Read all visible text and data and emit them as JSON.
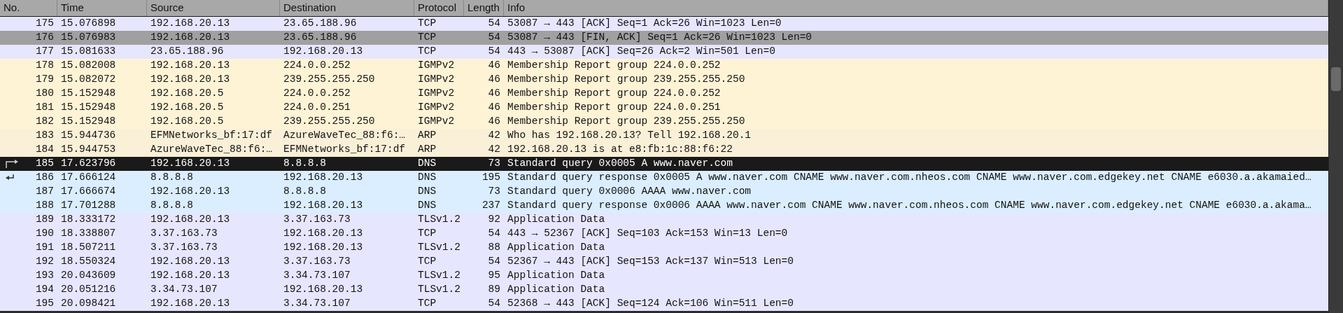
{
  "table": {
    "columns": [
      "No.",
      "Time",
      "Source",
      "Destination",
      "Protocol",
      "Length",
      "Info"
    ],
    "rows": [
      {
        "cells": [
          "175",
          "15.076898",
          "192.168.20.13",
          "23.65.188.96",
          "TCP",
          "54",
          "53087 → 443 [ACK] Seq=1 Ack=26 Win=1023 Len=0"
        ],
        "color": "#e7e6ff",
        "selected": false
      },
      {
        "cells": [
          "176",
          "15.076983",
          "192.168.20.13",
          "23.65.188.96",
          "TCP",
          "54",
          "53087 → 443 [FIN, ACK] Seq=1 Ack=26 Win=1023 Len=0"
        ],
        "color": "#a0a0a0",
        "selected": false
      },
      {
        "cells": [
          "177",
          "15.081633",
          "23.65.188.96",
          "192.168.20.13",
          "TCP",
          "54",
          "443 → 53087 [ACK] Seq=26 Ack=2 Win=501 Len=0"
        ],
        "color": "#e7e6ff",
        "selected": false
      },
      {
        "cells": [
          "178",
          "15.082008",
          "192.168.20.13",
          "224.0.0.252",
          "IGMPv2",
          "46",
          "Membership Report group 224.0.0.252"
        ],
        "color": "#fff3d6",
        "selected": false
      },
      {
        "cells": [
          "179",
          "15.082072",
          "192.168.20.13",
          "239.255.255.250",
          "IGMPv2",
          "46",
          "Membership Report group 239.255.255.250"
        ],
        "color": "#fff3d6",
        "selected": false
      },
      {
        "cells": [
          "180",
          "15.152948",
          "192.168.20.5",
          "224.0.0.252",
          "IGMPv2",
          "46",
          "Membership Report group 224.0.0.252"
        ],
        "color": "#fff3d6",
        "selected": false
      },
      {
        "cells": [
          "181",
          "15.152948",
          "192.168.20.5",
          "224.0.0.251",
          "IGMPv2",
          "46",
          "Membership Report group 224.0.0.251"
        ],
        "color": "#fff3d6",
        "selected": false
      },
      {
        "cells": [
          "182",
          "15.152948",
          "192.168.20.5",
          "239.255.255.250",
          "IGMPv2",
          "46",
          "Membership Report group 239.255.255.250"
        ],
        "color": "#fff3d6",
        "selected": false
      },
      {
        "cells": [
          "183",
          "15.944736",
          "EFMNetworks_bf:17:df",
          "AzureWaveTec_88:f6:…",
          "ARP",
          "42",
          "Who has 192.168.20.13? Tell 192.168.20.1"
        ],
        "color": "#faf0d7",
        "selected": false
      },
      {
        "cells": [
          "184",
          "15.944753",
          "AzureWaveTec_88:f6:…",
          "EFMNetworks_bf:17:df",
          "ARP",
          "42",
          "192.168.20.13 is at e8:fb:1c:88:f6:22"
        ],
        "color": "#faf0d7",
        "selected": false
      },
      {
        "cells": [
          "185",
          "17.623796",
          "192.168.20.13",
          "8.8.8.8",
          "DNS",
          "73",
          "Standard query 0x0005 A www.naver.com"
        ],
        "selected": true,
        "kind": "request"
      },
      {
        "cells": [
          "186",
          "17.666124",
          "8.8.8.8",
          "192.168.20.13",
          "DNS",
          "195",
          "Standard query response 0x0005 A www.naver.com CNAME www.naver.com.nheos.com CNAME www.naver.com.edgekey.net CNAME e6030.a.akamaied…"
        ],
        "color": "#daeeff",
        "selected": false,
        "kind": "response"
      },
      {
        "cells": [
          "187",
          "17.666674",
          "192.168.20.13",
          "8.8.8.8",
          "DNS",
          "73",
          "Standard query 0x0006 AAAA www.naver.com"
        ],
        "color": "#daeeff",
        "selected": false
      },
      {
        "cells": [
          "188",
          "17.701288",
          "8.8.8.8",
          "192.168.20.13",
          "DNS",
          "237",
          "Standard query response 0x0006 AAAA www.naver.com CNAME www.naver.com.nheos.com CNAME www.naver.com.edgekey.net CNAME e6030.a.akama…"
        ],
        "color": "#daeeff",
        "selected": false
      },
      {
        "cells": [
          "189",
          "18.333172",
          "192.168.20.13",
          "3.37.163.73",
          "TLSv1.2",
          "92",
          "Application Data"
        ],
        "color": "#e7e6ff",
        "selected": false
      },
      {
        "cells": [
          "190",
          "18.338807",
          "3.37.163.73",
          "192.168.20.13",
          "TCP",
          "54",
          "443 → 52367 [ACK] Seq=103 Ack=153 Win=13 Len=0"
        ],
        "color": "#e7e6ff",
        "selected": false
      },
      {
        "cells": [
          "191",
          "18.507211",
          "3.37.163.73",
          "192.168.20.13",
          "TLSv1.2",
          "88",
          "Application Data"
        ],
        "color": "#e7e6ff",
        "selected": false
      },
      {
        "cells": [
          "192",
          "18.550324",
          "192.168.20.13",
          "3.37.163.73",
          "TCP",
          "54",
          "52367 → 443 [ACK] Seq=153 Ack=137 Win=513 Len=0"
        ],
        "color": "#e7e6ff",
        "selected": false
      },
      {
        "cells": [
          "193",
          "20.043609",
          "192.168.20.13",
          "3.34.73.107",
          "TLSv1.2",
          "95",
          "Application Data"
        ],
        "color": "#e7e6ff",
        "selected": false
      },
      {
        "cells": [
          "194",
          "20.051216",
          "3.34.73.107",
          "192.168.20.13",
          "TLSv1.2",
          "89",
          "Application Data"
        ],
        "color": "#e7e6ff",
        "selected": false
      },
      {
        "cells": [
          "195",
          "20.098421",
          "192.168.20.13",
          "3.34.73.107",
          "TCP",
          "54",
          "52368 → 443 [ACK] Seq=124 Ack=106 Win=511 Len=0"
        ],
        "color": "#e7e6ff",
        "selected": false
      }
    ]
  }
}
